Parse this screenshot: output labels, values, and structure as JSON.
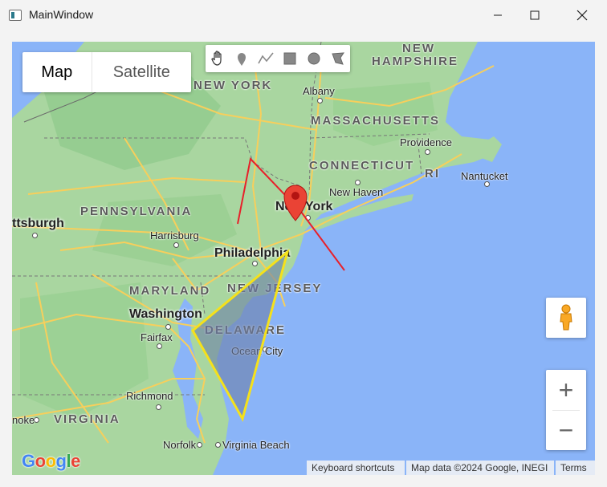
{
  "window": {
    "title": "MainWindow",
    "controls": {
      "minimize": "minimize-icon",
      "maximize": "maximize-icon",
      "close": "close-icon"
    }
  },
  "map_type": {
    "map_label": "Map",
    "satellite_label": "Satellite",
    "selected": "Map"
  },
  "drawing_tools": [
    {
      "name": "hand-icon"
    },
    {
      "name": "marker-icon"
    },
    {
      "name": "polyline-icon"
    },
    {
      "name": "rectangle-icon"
    },
    {
      "name": "circle-icon"
    },
    {
      "name": "polygon-icon"
    }
  ],
  "labels": {
    "new_hampshire_1": "NEW",
    "new_hampshire_2": "HAMPSHIRE",
    "new_york_state": "NEW YORK",
    "massachusetts": "MASSACHUSETTS",
    "connecticut": "CONNECTICUT",
    "ri": "RI",
    "pennsylvania": "PENNSYLVANIA",
    "maryland": "MARYLAND",
    "new_jersey": "NEW JERSEY",
    "delaware": "DELAWARE",
    "virginia": "VIRGINIA",
    "albany": "Albany",
    "providence": "Providence",
    "nantucket": "Nantucket",
    "new_haven": "New Haven",
    "new_york_city": "New York",
    "pittsburgh": "ttsburgh",
    "harrisburg": "Harrisburg",
    "philadelphia": "Philadelphia",
    "washington": "Washington",
    "fairfax": "Fairfax",
    "ocean_city": "Ocean City",
    "richmond": "Richmond",
    "norfolk": "Norfolk",
    "virginia_beach": "Virginia Beach",
    "roanoke": "noke"
  },
  "overlays": {
    "polyline_color": "#e8202a",
    "polygon_stroke": "#f5e11b",
    "polygon_fill": "#6d7fa8",
    "marker_color": "#ea4335"
  },
  "controls": {
    "pegman": "pegman-icon",
    "zoom_in": "+",
    "zoom_out": "−"
  },
  "attribution": {
    "logo": "Google",
    "shortcuts": "Keyboard shortcuts",
    "map_data": "Map data ©2024 Google, INEGI",
    "terms": "Terms"
  },
  "colors": {
    "water": "#8ab4f8",
    "land": "#a8d5a2",
    "road": "#fbd66b"
  }
}
